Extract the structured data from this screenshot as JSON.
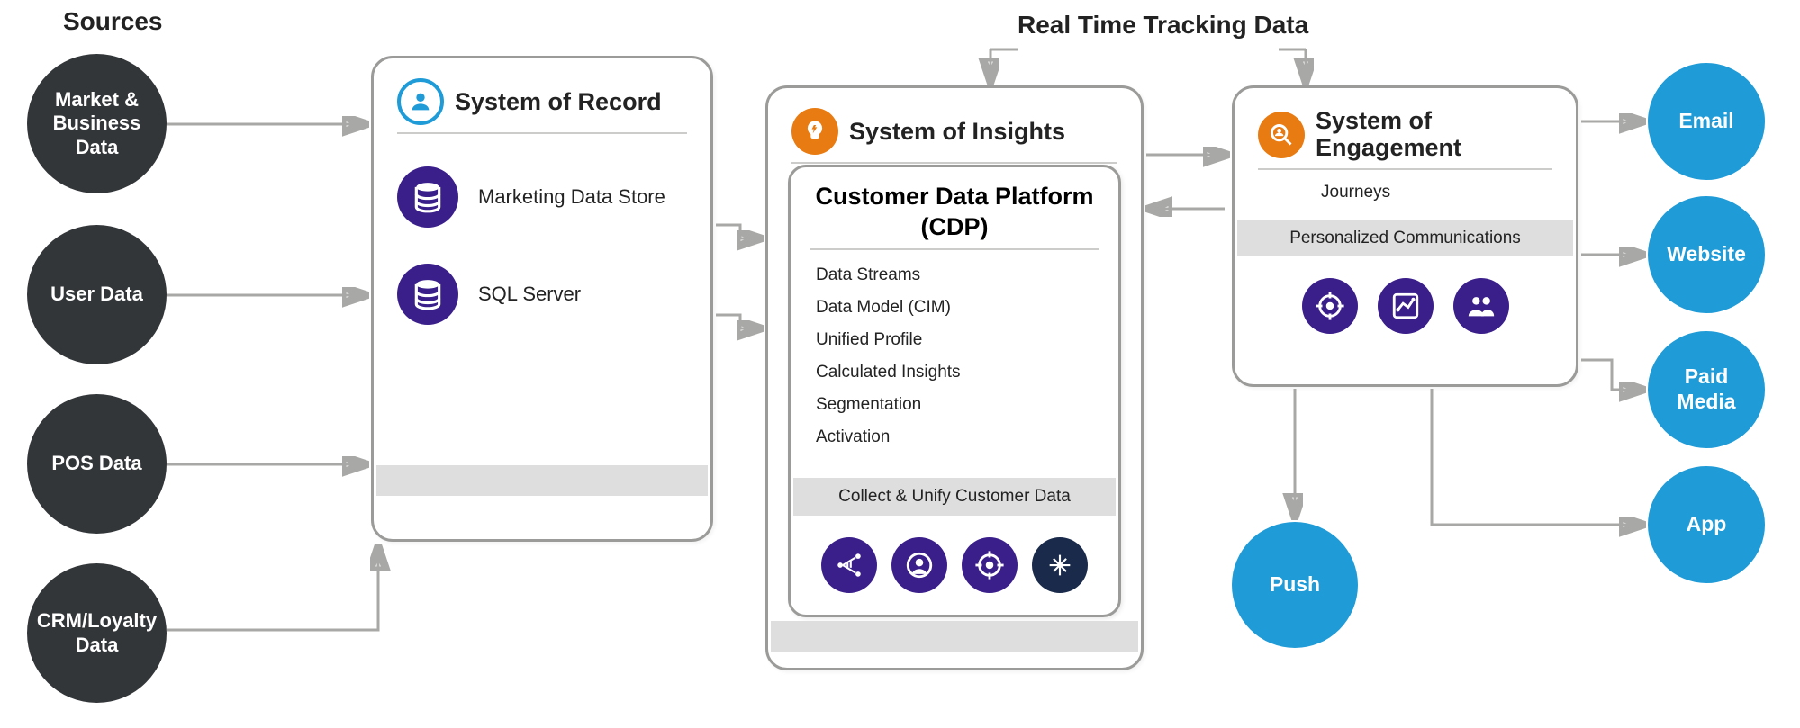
{
  "sources": {
    "heading": "Sources",
    "items": [
      "Market & Business Data",
      "User Data",
      "POS Data",
      "CRM/Loyalty Data"
    ]
  },
  "record": {
    "title": "System of Record",
    "items": [
      "Marketing Data Store",
      "SQL Server"
    ]
  },
  "insights": {
    "title": "System of Insights",
    "cdp": {
      "title": "Customer Data Platform (CDP)",
      "features": [
        "Data Streams",
        "Data Model (CIM)",
        "Unified Profile",
        "Calculated Insights",
        "Segmentation",
        "Activation"
      ],
      "band": "Collect & Unify Customer Data"
    }
  },
  "engagement": {
    "title": "System of Engagement",
    "subtitle": "Journeys",
    "band": "Personalized Communications"
  },
  "tracking_label": "Real Time Tracking Data",
  "channels": [
    "Email",
    "Website",
    "Paid Media",
    "App",
    "Push"
  ],
  "colors": {
    "dark": "#333639",
    "blue": "#1f9bd7",
    "purple": "#3a1f8a",
    "orange": "#e87c12",
    "grey": "#a8a8a6"
  },
  "icons": {
    "record_header": "user-circle-icon",
    "insights_header": "lightbulb-icon",
    "engagement_header": "magnify-user-icon",
    "db": "database-icon",
    "cdp_row": [
      "connect-icon",
      "profile-icon",
      "target-icon",
      "sparkle-icon"
    ],
    "engage_row": [
      "target-icon",
      "chart-icon",
      "people-icon"
    ]
  }
}
